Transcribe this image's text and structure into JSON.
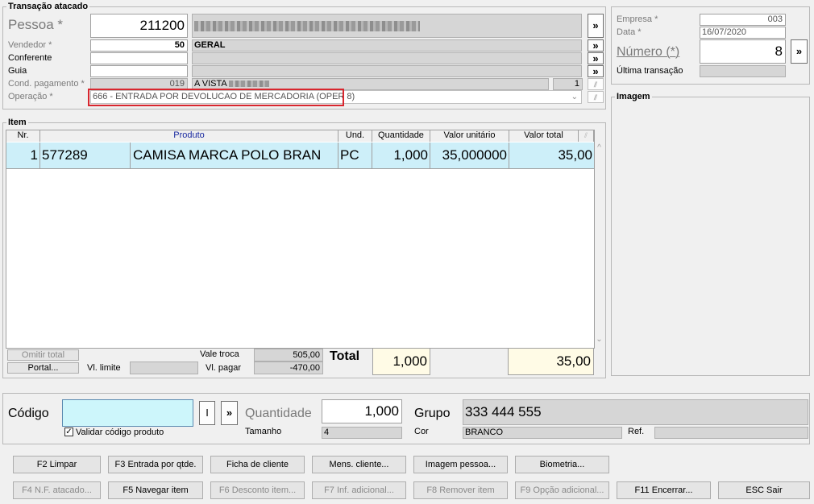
{
  "transacao": {
    "group_title": "Transação atacado",
    "pessoa_label": "Pessoa *",
    "pessoa_code": "211200",
    "vendedor_label": "Vendedor *",
    "vendedor_code": "50",
    "vendedor_name": "GERAL",
    "conferente_label": "Conferente",
    "guia_label": "Guia",
    "cond_label": "Cond. pagamento *",
    "cond_code": "019",
    "cond_name": "A VISTA",
    "cond_num": "1",
    "operacao_label": "Operação *",
    "operacao_value": "666 - ENTRADA POR DEVOLUCAO DE MERCADORIA (OPER 8)",
    "more_glyph": "»"
  },
  "right_panel": {
    "empresa_label": "Empresa *",
    "empresa_value": "003",
    "data_label": "Data *",
    "data_value": "16/07/2020",
    "numero_label": "Número (*)",
    "numero_value": "8",
    "ultima_label": "Última transação",
    "imagem_title": "Imagem"
  },
  "item": {
    "group_title": "Item",
    "columns": [
      "Nr.",
      "Produto",
      "Und.",
      "Quantidade",
      "Valor unitário",
      "Valor total"
    ],
    "row": {
      "nr": "1",
      "codigo": "577289",
      "produto": "CAMISA MARCA POLO BRAN",
      "und": "PC",
      "quantidade": "1,000",
      "valor_unitario": "35,000000",
      "valor_total": "35,00"
    },
    "omitir_total": "Omitir total",
    "portal": "Portal...",
    "vl_limite_label": "Vl. limite",
    "vale_troca_label": "Vale troca",
    "vale_troca_value": "505,00",
    "vl_pagar_label": "Vl. pagar",
    "vl_pagar_value": "-470,00",
    "total_label": "Total",
    "total_quantidade": "1,000",
    "total_valor": "35,00"
  },
  "entry": {
    "codigo_label": "Código",
    "codigo_value": "",
    "l_button": "I",
    "quantidade_label": "Quantidade",
    "quantidade_value": "1,000",
    "grupo_label": "Grupo",
    "grupo_value": "333 444 555",
    "validar_label": "Validar código produto",
    "tamanho_label": "Tamanho",
    "tamanho_value": "4",
    "cor_label": "Cor",
    "cor_value": "BRANCO",
    "ref_label": "Ref."
  },
  "buttons_row1": [
    "F2 Limpar",
    "F3 Entrada por qtde.",
    "Ficha de cliente",
    "Mens. cliente...",
    "Imagem pessoa...",
    "Biometria..."
  ],
  "buttons_row2": [
    "F4 N.F. atacado...",
    "F5 Navegar item",
    "F6 Desconto item...",
    "F7 Inf. adicional...",
    "F8 Remover item",
    "F9 Opção adicional...",
    "F11 Encerrar...",
    "ESC Sair"
  ]
}
